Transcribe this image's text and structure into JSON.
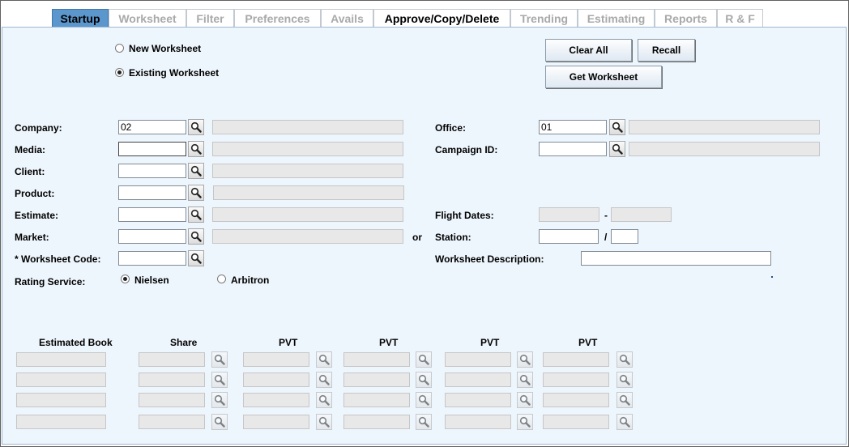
{
  "tabs": [
    {
      "label": "Startup",
      "state": "active"
    },
    {
      "label": "Worksheet",
      "state": "disabled"
    },
    {
      "label": "Filter",
      "state": "disabled"
    },
    {
      "label": "Preferences",
      "state": "disabled"
    },
    {
      "label": "Avails",
      "state": "disabled"
    },
    {
      "label": "Approve/Copy/Delete",
      "state": "enabled"
    },
    {
      "label": "Trending",
      "state": "disabled"
    },
    {
      "label": "Estimating",
      "state": "disabled"
    },
    {
      "label": "Reports",
      "state": "disabled"
    },
    {
      "label": "R & F",
      "state": "disabled"
    }
  ],
  "mode": {
    "new_label": "New Worksheet",
    "existing_label": "Existing Worksheet",
    "selected": "existing"
  },
  "buttons": {
    "clear_all": "Clear All",
    "recall": "Recall",
    "get_worksheet": "Get Worksheet"
  },
  "fields": {
    "company": {
      "label": "Company:",
      "value": "02"
    },
    "media": {
      "label": "Media:",
      "value": ""
    },
    "client": {
      "label": "Client:",
      "value": ""
    },
    "product": {
      "label": "Product:",
      "value": ""
    },
    "estimate": {
      "label": "Estimate:",
      "value": ""
    },
    "market": {
      "label": "Market:",
      "value": ""
    },
    "worksheet_code": {
      "label": "* Worksheet Code:",
      "value": ""
    },
    "office": {
      "label": "Office:",
      "value": "01"
    },
    "campaign_id": {
      "label": "Campaign ID:",
      "value": ""
    },
    "flight_dates": {
      "label": "Flight Dates:",
      "separator": "-"
    },
    "station": {
      "label": "Station:",
      "separator": "/"
    },
    "worksheet_description": {
      "label": "Worksheet Description:",
      "value": ""
    }
  },
  "or_label": "or",
  "rating_service": {
    "label": "Rating Service:",
    "options": [
      "Nielsen",
      "Arbitron"
    ],
    "selected": "Nielsen"
  },
  "book_grid": {
    "headers": [
      "Estimated Book",
      "Share",
      "PVT",
      "PVT",
      "PVT",
      "PVT"
    ],
    "row_count": 4
  },
  "colors": {
    "panel_bg": "#eef6fd",
    "active_tab": "#5b97cc",
    "readonly_field": "#e8e8e8"
  }
}
